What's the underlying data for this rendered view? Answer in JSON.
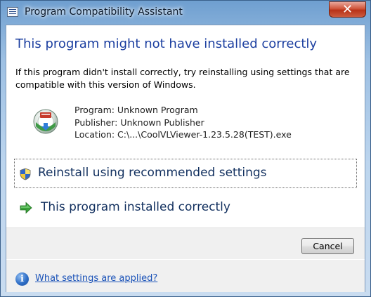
{
  "window": {
    "title": "Program Compatibility Assistant",
    "close_glyph": "✕",
    "app_icon": "compatibility-assistant-icon"
  },
  "main": {
    "heading": "This program might not have installed correctly",
    "description": "If this program didn't install correctly, try reinstalling using settings that are compatible with this version of Windows.",
    "program_icon": "installer-disc-icon",
    "details": {
      "program": "Program: Unknown Program",
      "publisher": "Publisher: Unknown Publisher",
      "location": "Location: C:\\...\\CoolVLViewer-1.23.5.28(TEST).exe"
    }
  },
  "commands": [
    {
      "label": "Reinstall using recommended settings",
      "icon": "uac-shield-icon",
      "focused": true
    },
    {
      "label": "This program installed correctly",
      "icon": "green-arrow-icon",
      "focused": false
    }
  ],
  "buttons": {
    "cancel": "Cancel"
  },
  "footer": {
    "info_icon": "info-icon",
    "link": "What settings are applied?"
  },
  "colors": {
    "heading": "#1c3fa0",
    "command_text": "#12305f",
    "link": "#1a52b8",
    "close_button": "#c0432a"
  }
}
